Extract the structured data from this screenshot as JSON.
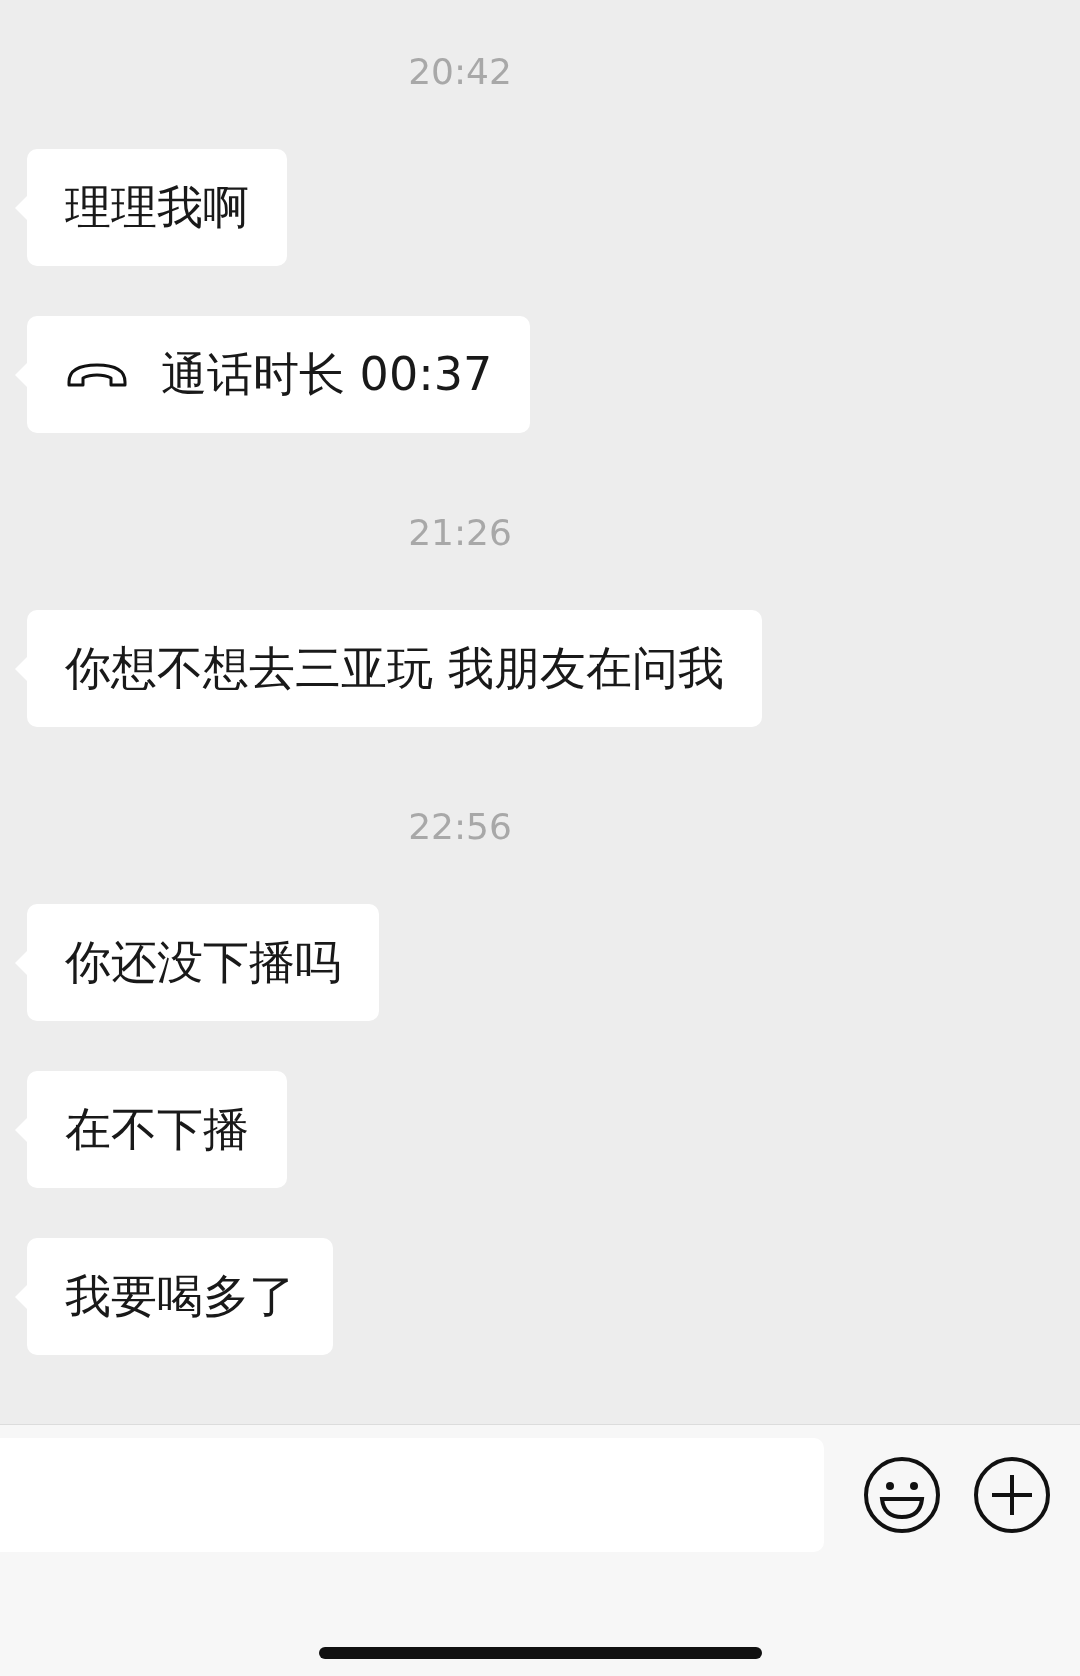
{
  "messages": [
    {
      "kind": "time",
      "text": "20:42"
    },
    {
      "kind": "text",
      "text": "理理我啊"
    },
    {
      "kind": "call",
      "text": "通话时长 00:37"
    },
    {
      "kind": "time",
      "text": "21:26"
    },
    {
      "kind": "text",
      "text": "你想不想去三亚玩 我朋友在问我"
    },
    {
      "kind": "time",
      "text": "22:56"
    },
    {
      "kind": "text",
      "text": "你还没下播吗"
    },
    {
      "kind": "text",
      "text": "在不下播"
    },
    {
      "kind": "text",
      "text": "我要喝多了"
    }
  ]
}
